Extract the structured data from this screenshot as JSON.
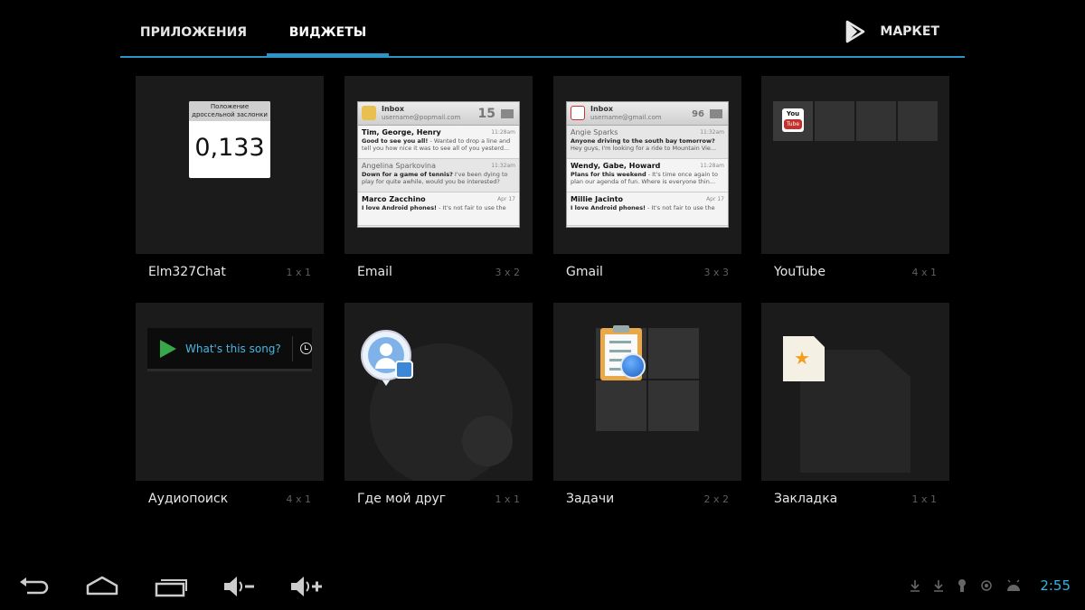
{
  "tabs": {
    "apps": "ПРИЛОЖЕНИЯ",
    "widgets": "ВИДЖЕТЫ",
    "market": "МАРКЕТ"
  },
  "widgets": [
    {
      "name": "Elm327Chat",
      "size": "1 x 1"
    },
    {
      "name": "Email",
      "size": "3 x 2"
    },
    {
      "name": "Gmail",
      "size": "3 x 3"
    },
    {
      "name": "YouTube",
      "size": "4 x 1"
    },
    {
      "name": "Аудиопоиск",
      "size": "4 x 1"
    },
    {
      "name": "Где мой друг",
      "size": "1 x 1"
    },
    {
      "name": "Задачи",
      "size": "2 x 2"
    },
    {
      "name": "Закладка",
      "size": "1 x 1"
    }
  ],
  "elm_preview": {
    "header": "Положение дроссельной заслонки",
    "value": "0,133"
  },
  "email_preview": {
    "title": "Inbox",
    "account": "username@popmail.com",
    "count": "15",
    "rows": [
      {
        "from": "Tim, George, Henry",
        "time": "11:28am",
        "subject": "Good to see you all!",
        "snippet": " - Wanted to drop a line and tell you how nice it was to see all of you yesterd..."
      },
      {
        "from": "Angelina Sparkovina",
        "time": "11:32am",
        "subject": "Down for a game of tennis?",
        "snippet": " I've been dying to play for quite awhile, would you be interested?"
      },
      {
        "from": "Marco Zacchino",
        "time": "Apr 17",
        "subject": "I love Android phones!",
        "snippet": " - It's not fair to use the"
      }
    ]
  },
  "gmail_preview": {
    "title": "Inbox",
    "account": "username@gmail.com",
    "count": "96",
    "rows": [
      {
        "from": "Angie Sparks",
        "time": "11:32am",
        "subject": "Anyone driving to the south bay tomorrow?",
        "snippet": " Hey guys, I'm looking for a ride to Mountain Vie..."
      },
      {
        "from": "Wendy, Gabe, Howard",
        "time": "11:28am",
        "subject": "Plans for this weekend",
        "snippet": " - It's time once again to plan our agenda of fun. Where is everyone thin..."
      },
      {
        "from": "Millie Jacinto",
        "time": "Apr 17",
        "subject": "I love Android phones!",
        "snippet": " - It's not fair to use the"
      }
    ]
  },
  "youtube_preview": {
    "logo_top": "You",
    "logo_bottom": "Tube"
  },
  "audio_preview": {
    "prompt": "What's this song?"
  },
  "bookmark_preview": {
    "star": "★"
  },
  "status_bar": {
    "time": "2:55"
  },
  "colors": {
    "accent": "#2a95c4",
    "clock": "#33b5e5",
    "tile": "#1b1b1b"
  }
}
